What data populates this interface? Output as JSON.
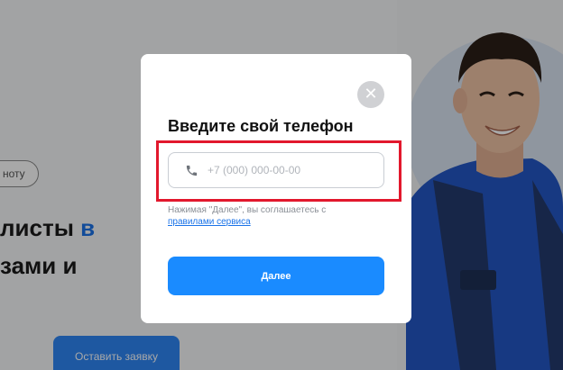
{
  "background": {
    "badge_text": "ноту",
    "heading_line1": "листы",
    "heading_accent": "в",
    "heading_line2": "зами и",
    "cta_label": "Оставить заявку"
  },
  "modal": {
    "close_glyph": "✕",
    "title": "Введите свой телефон",
    "phone": {
      "value": "",
      "placeholder": "+7 (000) 000-00-00",
      "icon": "phone-icon"
    },
    "consent_text": "Нажимая \"Далее\", вы соглашаетесь с",
    "consent_link": "правилами сервиса",
    "submit_label": "Далее"
  },
  "colors": {
    "accent": "#1a8bff",
    "highlight": "#e2182d",
    "overlay": "rgba(0,0,0,0.34)"
  }
}
